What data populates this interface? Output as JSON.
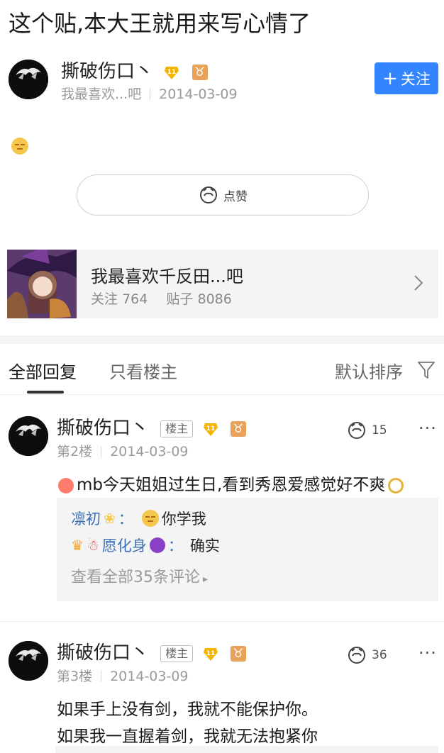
{
  "post": {
    "title": "这个贴,本大王就用来写心情了",
    "author": "撕破伤口丶",
    "level": "11",
    "zodiac": "♉",
    "forum_short": "我最喜欢...吧",
    "date": "2014-03-09",
    "follow_label": "关注",
    "like_label": "点赞"
  },
  "forum": {
    "name": "我最喜欢千反田...吧",
    "follow_label": "关注",
    "follow_count": "764",
    "posts_label": "贴子",
    "posts_count": "8086"
  },
  "tabs": {
    "all": "全部回复",
    "only_owner": "只看楼主",
    "sort": "默认排序"
  },
  "replies": [
    {
      "author": "撕破伤口丶",
      "owner_tag": "楼主",
      "level": "11",
      "zodiac": "♉",
      "floor": "第2楼",
      "date": "2014-03-09",
      "likes": "15",
      "text": "mb今天姐姐过生日,看到秀恩爱感觉好不爽",
      "comments": [
        {
          "user": "凛初",
          "sep": "：",
          "text": "你学我"
        },
        {
          "user": "愿化身",
          "sep": "：",
          "text": "确实"
        }
      ],
      "view_all": "查看全部35条评论"
    },
    {
      "author": "撕破伤口丶",
      "owner_tag": "楼主",
      "level": "11",
      "zodiac": "♉",
      "floor": "第3楼",
      "date": "2014-03-09",
      "likes": "36",
      "text_line1": "如果手上没有剑，我就不能保护你。",
      "text_line2": "如果我一直握着剑，我就无法抱紧你"
    }
  ],
  "colors": {
    "accent": "#3385ff",
    "comment_user": "#3a6fb7",
    "level_badge": "#f5b400",
    "zodiac_badge": "#e8a25a"
  }
}
